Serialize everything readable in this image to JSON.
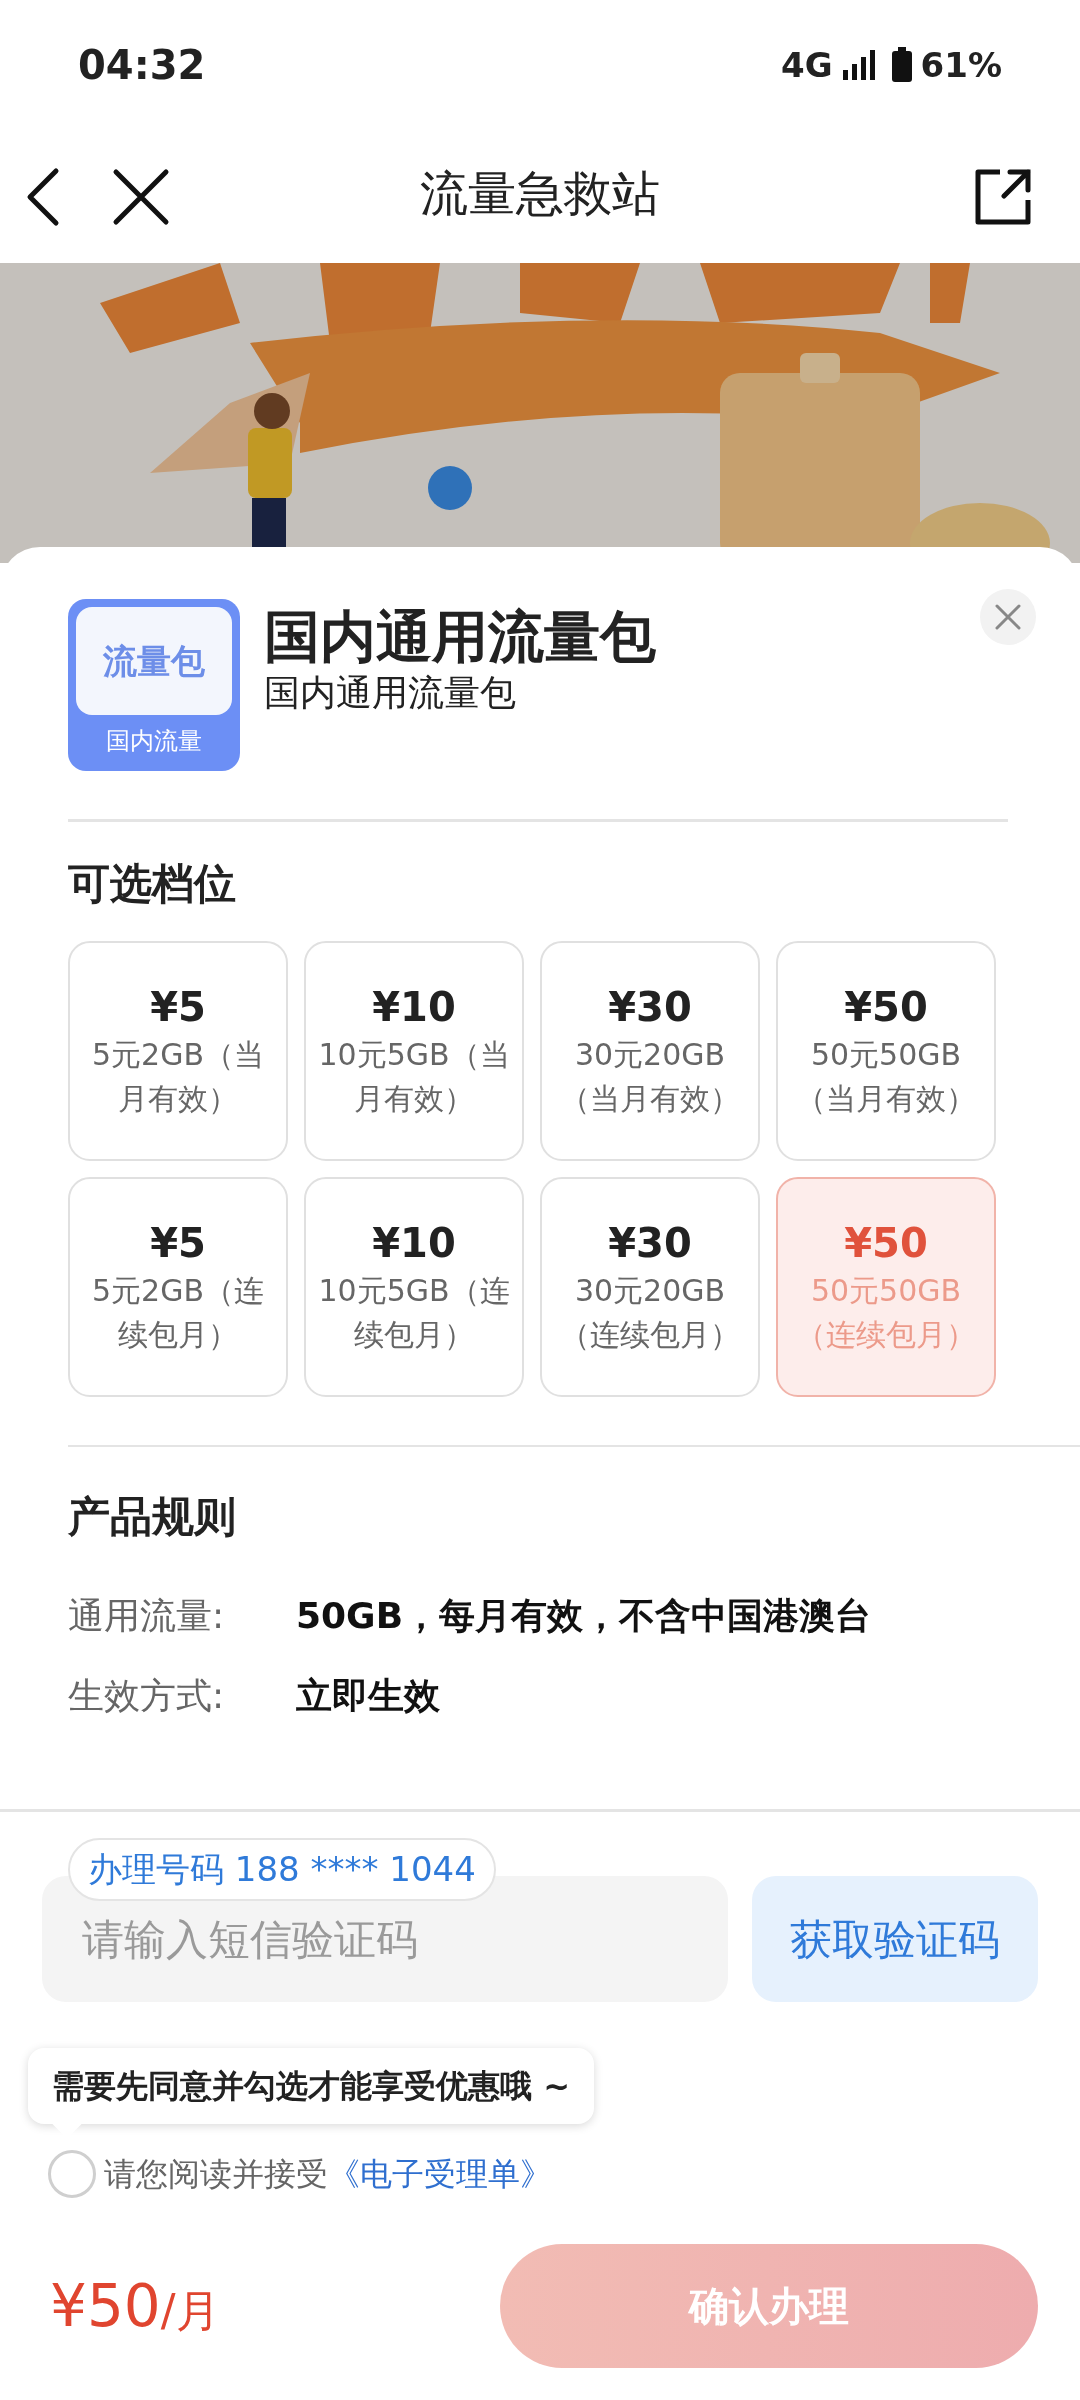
{
  "status_bar": {
    "time": "04:32",
    "network": "4G",
    "battery": "61%"
  },
  "header": {
    "title": "流量急救站"
  },
  "product": {
    "icon_title": "流量包",
    "icon_label": "国内流量",
    "title": "国内通用流量包",
    "subtitle": "国内通用流量包"
  },
  "options": {
    "title": "可选档位",
    "items": [
      {
        "price": "¥5",
        "desc": "5元2GB（当月有效）",
        "selected": false
      },
      {
        "price": "¥10",
        "desc": "10元5GB（当月有效）",
        "selected": false
      },
      {
        "price": "¥30",
        "desc": "30元20GB（当月有效）",
        "selected": false
      },
      {
        "price": "¥50",
        "desc": "50元50GB（当月有效）",
        "selected": false
      },
      {
        "price": "¥5",
        "desc": "5元2GB（连续包月）",
        "selected": false
      },
      {
        "price": "¥10",
        "desc": "10元5GB（连续包月）",
        "selected": false
      },
      {
        "price": "¥30",
        "desc": "30元20GB（连续包月）",
        "selected": false
      },
      {
        "price": "¥50",
        "desc": "50元50GB（连续包月）",
        "selected": true
      }
    ]
  },
  "rules": {
    "title": "产品规则",
    "rows": [
      {
        "label": "通用流量:",
        "value": "50GB，每月有效，不含中国港澳台"
      },
      {
        "label": "生效方式:",
        "value": "立即生效"
      }
    ]
  },
  "form": {
    "phone_tag": "办理号码 188 **** 1044",
    "placeholder": "请输入短信验证码",
    "code_button": "获取验证码"
  },
  "agreement": {
    "tooltip": "需要先同意并勾选才能享受优惠哦 ~",
    "checked": false,
    "text": "请您阅读并接受",
    "link": "《电子受理单》"
  },
  "footer": {
    "price": "¥50",
    "unit": "/月",
    "button": "确认办理",
    "disabled": true
  }
}
